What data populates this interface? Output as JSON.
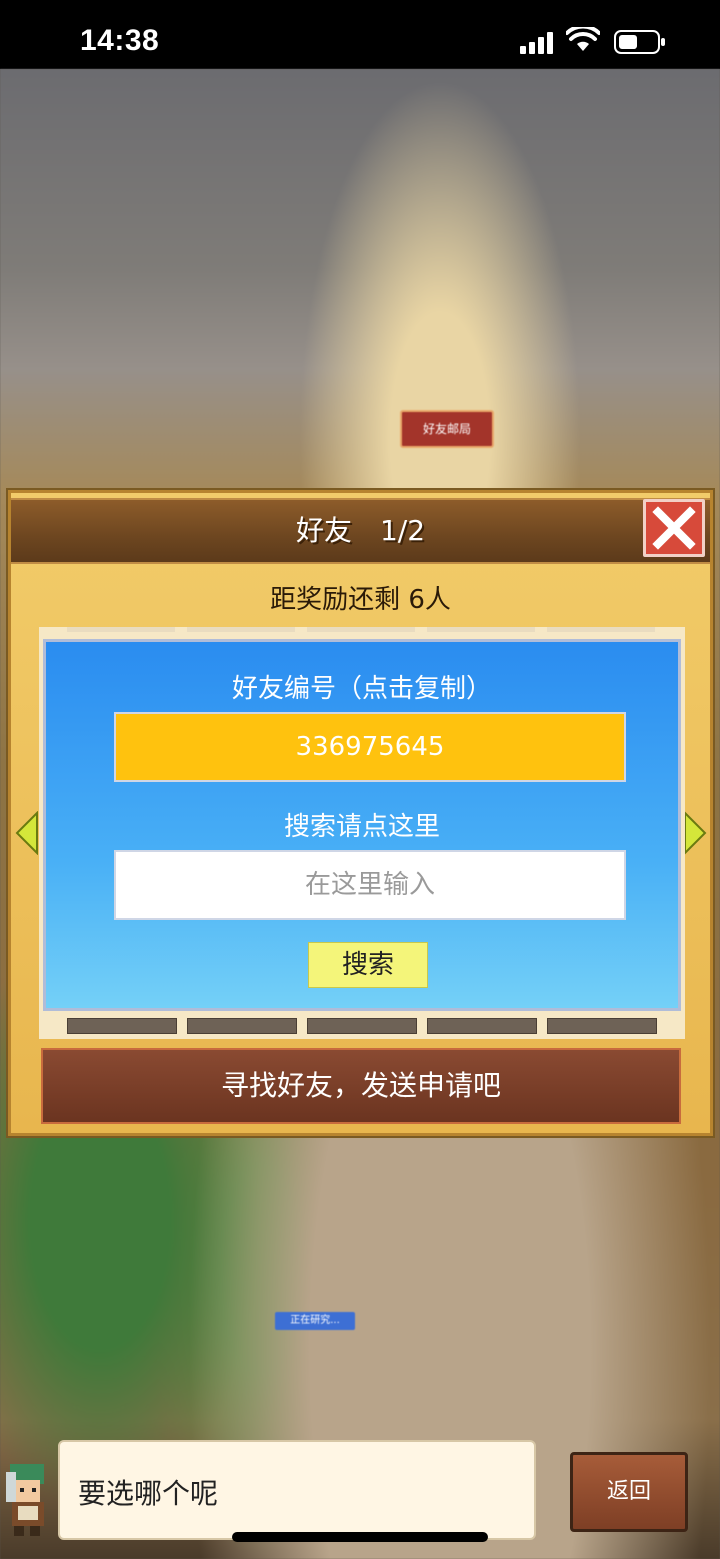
{
  "status_bar": {
    "time": "14:38"
  },
  "map": {
    "post_office_sign": "好友邮局",
    "research_tag": "正在研究..."
  },
  "dialog": {
    "title": "好友　1/2",
    "subtitle": "距奖励还剩 6人",
    "friend_id_label": "好友编号（点击复制）",
    "friend_id": "336975645",
    "search_label": "搜索请点这里",
    "search_placeholder": "在这里输入",
    "search_button": "搜索",
    "find_friends_button": "寻找好友，发送申请吧"
  },
  "npc": {
    "speech": "要选哪个呢",
    "back_button": "返回"
  },
  "colors": {
    "panel_blue": "#2a8cf0",
    "id_box_yellow": "#ffc20e",
    "close_red": "#d74a3a"
  }
}
